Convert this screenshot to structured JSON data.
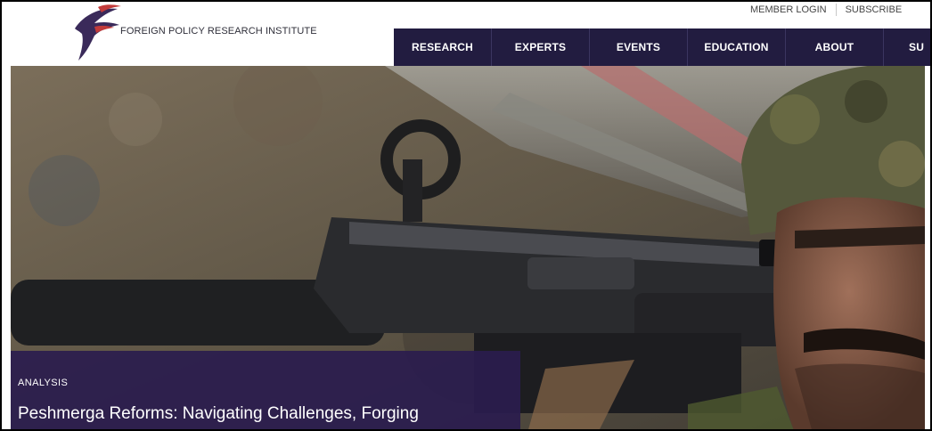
{
  "header": {
    "logo_text": "FOREIGN POLICY RESEARCH INSTITUTE",
    "utility_links": [
      "MEMBER LOGIN",
      "SUBSCRIBE"
    ],
    "nav": [
      "RESEARCH",
      "EXPERTS",
      "EVENTS",
      "EDUCATION",
      "ABOUT",
      "SU"
    ]
  },
  "hero": {
    "category": "ANALYSIS",
    "title": "Peshmerga Reforms: Navigating Challenges, Forging"
  },
  "colors": {
    "nav_bg": "#221c40",
    "caption_bg": "#2a1c4e",
    "brand_mark": "#3a2a5a"
  },
  "icons": {
    "logo": "fpri-bird-logo-icon"
  }
}
